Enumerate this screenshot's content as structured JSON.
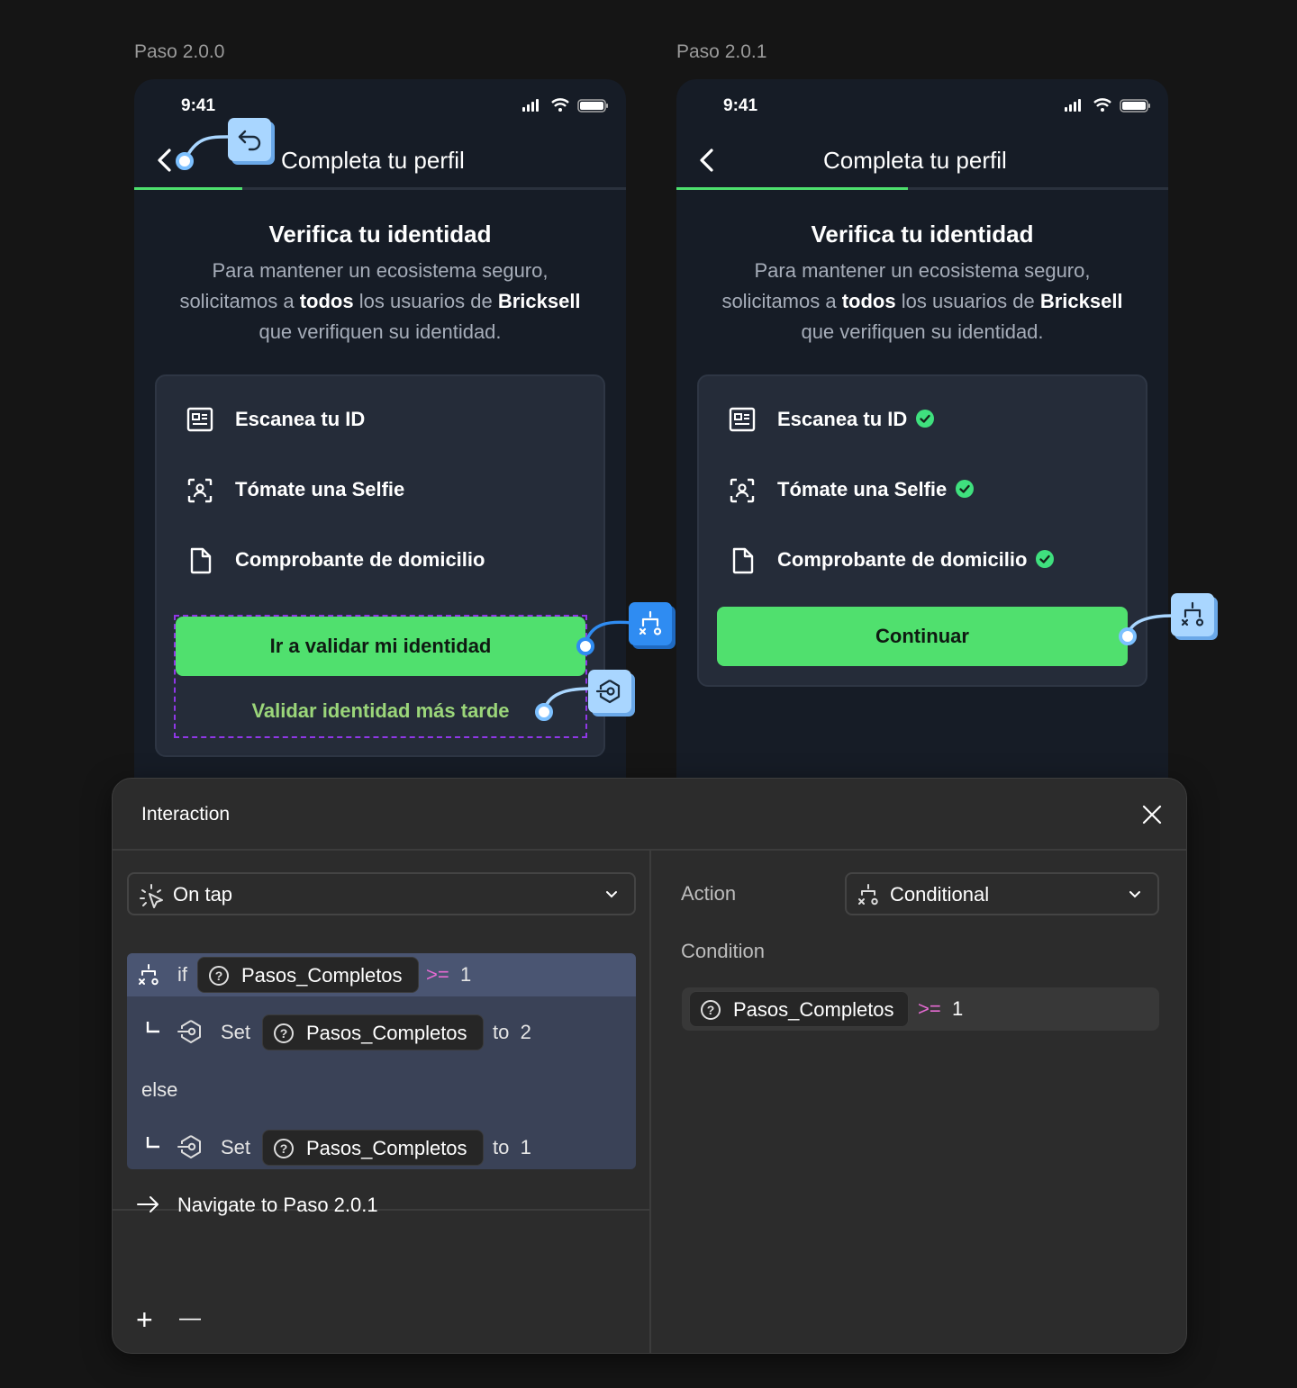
{
  "frames": [
    {
      "label": "Paso 2.0.0",
      "time": "9:41",
      "title": "Completa tu perfil",
      "heading": "Verifica tu identidad",
      "desc_1": "Para mantener un ecosistema seguro,",
      "desc_2_pre": "solicitamos a ",
      "desc_2_bold1": "todos",
      "desc_2_mid": " los usuarios de ",
      "desc_2_bold2": "Bricksell",
      "desc_3": "que verifiquen su identidad.",
      "items": [
        "Escanea tu ID",
        "Tómate una Selfie",
        "Comprobante de domicilio"
      ],
      "primary_button": "Ir a validar mi identidad",
      "secondary_button": "Validar identidad más tarde",
      "progress": 0.22
    },
    {
      "label": "Paso 2.0.1",
      "time": "9:41",
      "title": "Completa tu perfil",
      "heading": "Verifica tu identidad",
      "desc_1": "Para mantener un ecosistema seguro,",
      "desc_2_pre": "solicitamos a ",
      "desc_2_bold1": "todos",
      "desc_2_mid": " los usuarios de ",
      "desc_2_bold2": "Bricksell",
      "desc_3": "que verifiquen su identidad.",
      "items": [
        "Escanea tu ID",
        "Tómate una Selfie",
        "Comprobante de domicilio"
      ],
      "primary_button": "Continuar",
      "progress": 0.47
    }
  ],
  "panel": {
    "title": "Interaction",
    "trigger": "On tap",
    "logic": {
      "if_kw": "if",
      "if_var": "Pasos_Completos",
      "if_op": ">=",
      "if_val": "1",
      "then_kw": "Set",
      "then_var": "Pasos_Completos",
      "then_to": "to",
      "then_val": "2",
      "else_kw": "else",
      "else_set_kw": "Set",
      "else_var": "Pasos_Completos",
      "else_to": "to",
      "else_val": "1"
    },
    "navigate_kw": "Navigate to",
    "navigate_target": "Paso 2.0.1",
    "action_label": "Action",
    "action_value": "Conditional",
    "condition_label": "Condition",
    "condition_var": "Pasos_Completos",
    "condition_op": ">=",
    "condition_val": "1",
    "add_symbol": "+",
    "remove_symbol": "—"
  },
  "colors": {
    "accent_green": "#50e06e",
    "check_green": "#3fe07e",
    "node_blue": "#2f8cf2",
    "node_light": "#a9d6ff",
    "selection_purple": "#8f37e6",
    "operator_pink": "#e56ad2"
  }
}
